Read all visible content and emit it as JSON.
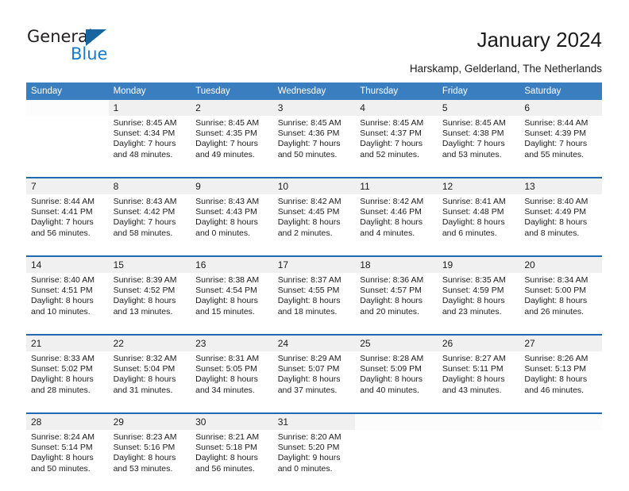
{
  "brand": {
    "name_part1": "General",
    "name_part2": "Blue",
    "accent_color": "#1a7ac7",
    "triangle_color": "#16659f"
  },
  "header": {
    "title": "January 2024",
    "subtitle": "Harskamp, Gelderland, The Netherlands"
  },
  "calendar": {
    "header_bg": "#3a7ebf",
    "separator_color": "#1f6ab0",
    "daynum_bg": "#f0f0f0",
    "columns": [
      "Sunday",
      "Monday",
      "Tuesday",
      "Wednesday",
      "Thursday",
      "Friday",
      "Saturday"
    ],
    "weeks": [
      [
        {
          "day": "",
          "lines": []
        },
        {
          "day": "1",
          "lines": [
            "Sunrise: 8:45 AM",
            "Sunset: 4:34 PM",
            "Daylight: 7 hours",
            "and 48 minutes."
          ]
        },
        {
          "day": "2",
          "lines": [
            "Sunrise: 8:45 AM",
            "Sunset: 4:35 PM",
            "Daylight: 7 hours",
            "and 49 minutes."
          ]
        },
        {
          "day": "3",
          "lines": [
            "Sunrise: 8:45 AM",
            "Sunset: 4:36 PM",
            "Daylight: 7 hours",
            "and 50 minutes."
          ]
        },
        {
          "day": "4",
          "lines": [
            "Sunrise: 8:45 AM",
            "Sunset: 4:37 PM",
            "Daylight: 7 hours",
            "and 52 minutes."
          ]
        },
        {
          "day": "5",
          "lines": [
            "Sunrise: 8:45 AM",
            "Sunset: 4:38 PM",
            "Daylight: 7 hours",
            "and 53 minutes."
          ]
        },
        {
          "day": "6",
          "lines": [
            "Sunrise: 8:44 AM",
            "Sunset: 4:39 PM",
            "Daylight: 7 hours",
            "and 55 minutes."
          ]
        }
      ],
      [
        {
          "day": "7",
          "lines": [
            "Sunrise: 8:44 AM",
            "Sunset: 4:41 PM",
            "Daylight: 7 hours",
            "and 56 minutes."
          ]
        },
        {
          "day": "8",
          "lines": [
            "Sunrise: 8:43 AM",
            "Sunset: 4:42 PM",
            "Daylight: 7 hours",
            "and 58 minutes."
          ]
        },
        {
          "day": "9",
          "lines": [
            "Sunrise: 8:43 AM",
            "Sunset: 4:43 PM",
            "Daylight: 8 hours",
            "and 0 minutes."
          ]
        },
        {
          "day": "10",
          "lines": [
            "Sunrise: 8:42 AM",
            "Sunset: 4:45 PM",
            "Daylight: 8 hours",
            "and 2 minutes."
          ]
        },
        {
          "day": "11",
          "lines": [
            "Sunrise: 8:42 AM",
            "Sunset: 4:46 PM",
            "Daylight: 8 hours",
            "and 4 minutes."
          ]
        },
        {
          "day": "12",
          "lines": [
            "Sunrise: 8:41 AM",
            "Sunset: 4:48 PM",
            "Daylight: 8 hours",
            "and 6 minutes."
          ]
        },
        {
          "day": "13",
          "lines": [
            "Sunrise: 8:40 AM",
            "Sunset: 4:49 PM",
            "Daylight: 8 hours",
            "and 8 minutes."
          ]
        }
      ],
      [
        {
          "day": "14",
          "lines": [
            "Sunrise: 8:40 AM",
            "Sunset: 4:51 PM",
            "Daylight: 8 hours",
            "and 10 minutes."
          ]
        },
        {
          "day": "15",
          "lines": [
            "Sunrise: 8:39 AM",
            "Sunset: 4:52 PM",
            "Daylight: 8 hours",
            "and 13 minutes."
          ]
        },
        {
          "day": "16",
          "lines": [
            "Sunrise: 8:38 AM",
            "Sunset: 4:54 PM",
            "Daylight: 8 hours",
            "and 15 minutes."
          ]
        },
        {
          "day": "17",
          "lines": [
            "Sunrise: 8:37 AM",
            "Sunset: 4:55 PM",
            "Daylight: 8 hours",
            "and 18 minutes."
          ]
        },
        {
          "day": "18",
          "lines": [
            "Sunrise: 8:36 AM",
            "Sunset: 4:57 PM",
            "Daylight: 8 hours",
            "and 20 minutes."
          ]
        },
        {
          "day": "19",
          "lines": [
            "Sunrise: 8:35 AM",
            "Sunset: 4:59 PM",
            "Daylight: 8 hours",
            "and 23 minutes."
          ]
        },
        {
          "day": "20",
          "lines": [
            "Sunrise: 8:34 AM",
            "Sunset: 5:00 PM",
            "Daylight: 8 hours",
            "and 26 minutes."
          ]
        }
      ],
      [
        {
          "day": "21",
          "lines": [
            "Sunrise: 8:33 AM",
            "Sunset: 5:02 PM",
            "Daylight: 8 hours",
            "and 28 minutes."
          ]
        },
        {
          "day": "22",
          "lines": [
            "Sunrise: 8:32 AM",
            "Sunset: 5:04 PM",
            "Daylight: 8 hours",
            "and 31 minutes."
          ]
        },
        {
          "day": "23",
          "lines": [
            "Sunrise: 8:31 AM",
            "Sunset: 5:05 PM",
            "Daylight: 8 hours",
            "and 34 minutes."
          ]
        },
        {
          "day": "24",
          "lines": [
            "Sunrise: 8:29 AM",
            "Sunset: 5:07 PM",
            "Daylight: 8 hours",
            "and 37 minutes."
          ]
        },
        {
          "day": "25",
          "lines": [
            "Sunrise: 8:28 AM",
            "Sunset: 5:09 PM",
            "Daylight: 8 hours",
            "and 40 minutes."
          ]
        },
        {
          "day": "26",
          "lines": [
            "Sunrise: 8:27 AM",
            "Sunset: 5:11 PM",
            "Daylight: 8 hours",
            "and 43 minutes."
          ]
        },
        {
          "day": "27",
          "lines": [
            "Sunrise: 8:26 AM",
            "Sunset: 5:13 PM",
            "Daylight: 8 hours",
            "and 46 minutes."
          ]
        }
      ],
      [
        {
          "day": "28",
          "lines": [
            "Sunrise: 8:24 AM",
            "Sunset: 5:14 PM",
            "Daylight: 8 hours",
            "and 50 minutes."
          ]
        },
        {
          "day": "29",
          "lines": [
            "Sunrise: 8:23 AM",
            "Sunset: 5:16 PM",
            "Daylight: 8 hours",
            "and 53 minutes."
          ]
        },
        {
          "day": "30",
          "lines": [
            "Sunrise: 8:21 AM",
            "Sunset: 5:18 PM",
            "Daylight: 8 hours",
            "and 56 minutes."
          ]
        },
        {
          "day": "31",
          "lines": [
            "Sunrise: 8:20 AM",
            "Sunset: 5:20 PM",
            "Daylight: 9 hours",
            "and 0 minutes."
          ]
        },
        {
          "day": "",
          "lines": []
        },
        {
          "day": "",
          "lines": []
        },
        {
          "day": "",
          "lines": []
        }
      ]
    ]
  }
}
